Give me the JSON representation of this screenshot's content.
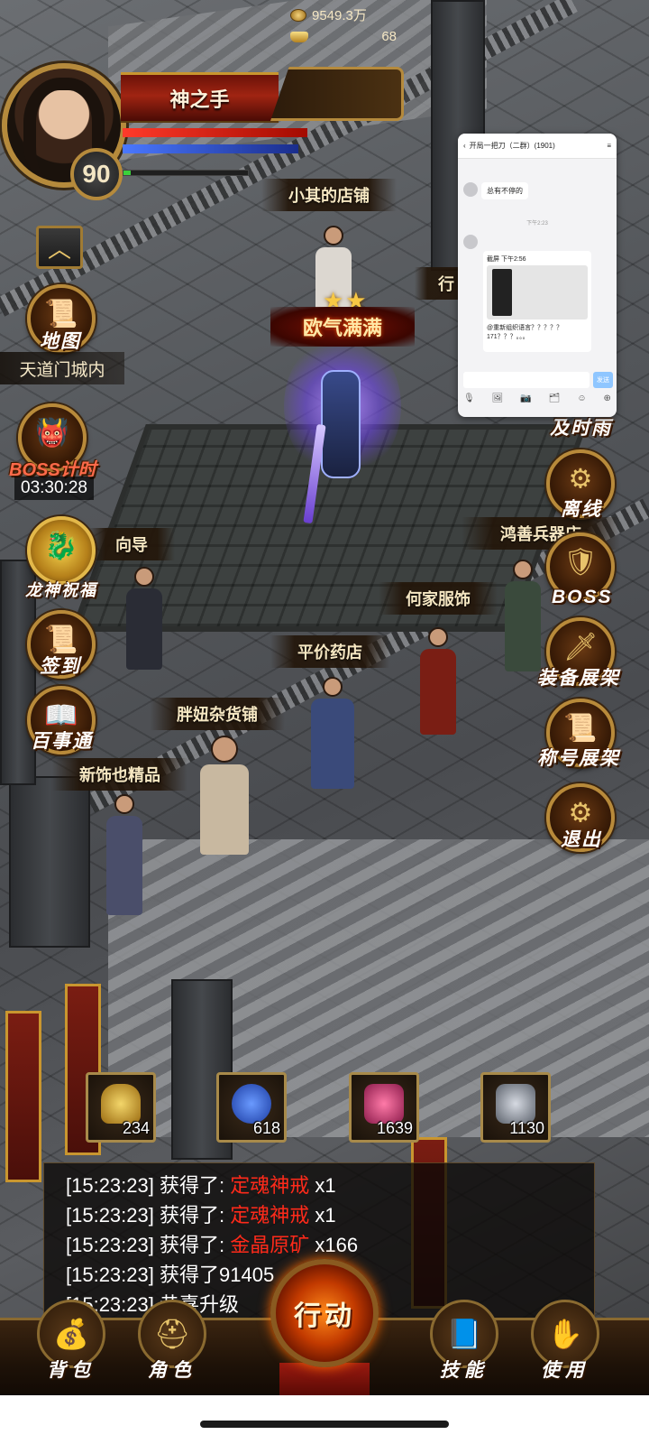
{
  "player": {
    "name": "神之手",
    "level": "90",
    "gold": "9549.3万",
    "ingots": "68",
    "location": "天道门城内"
  },
  "boss_timer": {
    "label": "BOSS计时",
    "time": "03:30:28"
  },
  "left_menu": [
    {
      "icon": "collapse-icon",
      "label": ""
    },
    {
      "icon": "map-icon",
      "label": "地图"
    },
    {
      "icon": "dragon-icon",
      "label": "龙神祝福"
    },
    {
      "icon": "checkin-icon",
      "label": "签到"
    },
    {
      "icon": "scroll-icon",
      "label": "百事通"
    }
  ],
  "right_menu": [
    {
      "icon": "offline-icon",
      "label": "离线"
    },
    {
      "icon": "boss-icon",
      "label": "BOSS"
    },
    {
      "icon": "equipment-rack-icon",
      "label": "装备展架"
    },
    {
      "icon": "title-rack-icon",
      "label": "称号展架"
    },
    {
      "icon": "exit-icon",
      "label": "退出"
    }
  ],
  "right_partial_labels": [
    "行",
    "及时雨"
  ],
  "hero_title": "欧气满满",
  "shops": {
    "shop_xiaoqi": "小其的店铺",
    "guide": "向导",
    "hongshan": "鸿善兵器店",
    "hejia": "何家服饰",
    "pingjia": "平价药店",
    "pangniu": "胖妞杂货铺",
    "xinshi": "新饰也精品"
  },
  "items": [
    {
      "name": "potion",
      "count": "234",
      "color": "#c8a23a"
    },
    {
      "name": "blue-potion",
      "count": "618",
      "color": "#2a56c8"
    },
    {
      "name": "scroll",
      "count": "1639",
      "color": "#c83a6a"
    },
    {
      "name": "ore",
      "count": "1130",
      "color": "#9aa0aa"
    }
  ],
  "log": [
    {
      "time": "[15:23:23]",
      "text": "获得了:",
      "item": "定魂神戒",
      "suffix": "x1"
    },
    {
      "time": "[15:23:23]",
      "text": "获得了:",
      "item": "定魂神戒",
      "suffix": "x1"
    },
    {
      "time": "[15:23:23]",
      "text": "获得了:",
      "item": "金晶原矿",
      "suffix": "x166"
    },
    {
      "time": "[15:23:23]",
      "text": "获得了91405",
      "item": "",
      "suffix": ""
    },
    {
      "time": "[15:23:23]",
      "text": "恭喜升级",
      "item": "",
      "suffix": ""
    }
  ],
  "bottom_bar": {
    "bag": "背包",
    "character": "角色",
    "action": "行动",
    "skills": "技能",
    "use": "使用"
  },
  "chat_overlay": {
    "title": "开局一把刀（二群）(1901)",
    "msg1": "总有不停的",
    "time": "下午2:23",
    "card_caption": "截屏 下午2:56",
    "card_text": "@重新组织语言？？？？？171？？？。。。",
    "send": "发送"
  }
}
